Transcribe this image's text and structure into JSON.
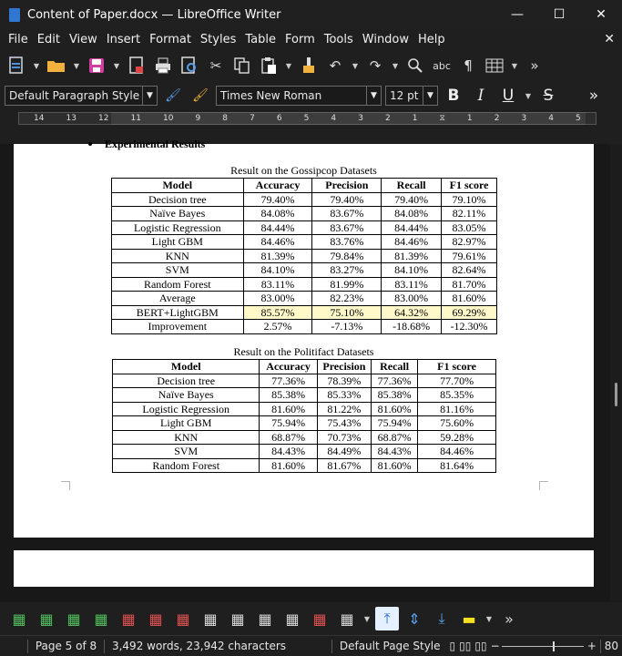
{
  "window": {
    "title": "Content of Paper.docx — LibreOffice Writer",
    "minimize": "—",
    "maximize": "☐",
    "close": "✕"
  },
  "menu": [
    "File",
    "Edit",
    "View",
    "Insert",
    "Format",
    "Styles",
    "Table",
    "Form",
    "Tools",
    "Window",
    "Help"
  ],
  "menu_close": "✕",
  "toolbar_icons": [
    "new-document-icon",
    "open-folder-icon",
    "save-icon",
    "export-pdf-icon",
    "print-icon",
    "print-preview-icon",
    "cut-icon",
    "copy-icon",
    "paste-icon",
    "clone-formatting-icon",
    "undo-icon",
    "redo-icon",
    "find-replace-icon",
    "spelling-icon",
    "formatting-marks-icon",
    "insert-table-icon",
    "more-icon"
  ],
  "toolbar_spelling_label": "abc",
  "formatting": {
    "paragraph_style": "Default Paragraph Style",
    "font_name": "Times New Roman",
    "font_size": "12 pt",
    "bold": "B",
    "italic": "I",
    "underline": "U",
    "strike": "S",
    "more": "»"
  },
  "ruler": {
    "ticks": [
      "14",
      "13",
      "12",
      "11",
      "10",
      "9",
      "8",
      "7",
      "6",
      "5",
      "4",
      "3",
      "2",
      "1",
      "1",
      "2",
      "3",
      "4",
      "5"
    ]
  },
  "document": {
    "section_heading": "Experimental Results",
    "table1": {
      "caption": "Result on the Gossipcop Datasets",
      "headers": [
        "Model",
        "Accuracy",
        "Precision",
        "Recall",
        "F1 score"
      ],
      "rows": [
        [
          "Decision tree",
          "79.40%",
          "79.40%",
          "79.40%",
          "79.10%"
        ],
        [
          "Naïve Bayes",
          "84.08%",
          "83.67%",
          "84.08%",
          "82.11%"
        ],
        [
          "Logistic Regression",
          "84.44%",
          "83.67%",
          "84.44%",
          "83.05%"
        ],
        [
          "Light GBM",
          "84.46%",
          "83.76%",
          "84.46%",
          "82.97%"
        ],
        [
          "KNN",
          "81.39%",
          "79.84%",
          "81.39%",
          "79.61%"
        ],
        [
          "SVM",
          "84.10%",
          "83.27%",
          "84.10%",
          "82.64%"
        ],
        [
          "Random Forest",
          "83.11%",
          "81.99%",
          "83.11%",
          "81.70%"
        ],
        [
          "Average",
          "83.00%",
          "82.23%",
          "83.00%",
          "81.60%"
        ],
        [
          "BERT+LightGBM",
          "85.57%",
          "75.10%",
          "64.32%",
          "69.29%"
        ],
        [
          "Improvement",
          "2.57%",
          "-7.13%",
          "-18.68%",
          "-12.30%"
        ]
      ]
    },
    "table2": {
      "caption": "Result on the Politifact Datasets",
      "headers": [
        "Model",
        "Accuracy",
        "Precision",
        "Recall",
        "F1 score"
      ],
      "rows": [
        [
          "Decision tree",
          "77.36%",
          "78.39%",
          "77.36%",
          "77.70%"
        ],
        [
          "Naïve Bayes",
          "85.38%",
          "85.33%",
          "85.38%",
          "85.35%"
        ],
        [
          "Logistic Regression",
          "81.60%",
          "81.22%",
          "81.60%",
          "81.16%"
        ],
        [
          "Light GBM",
          "75.94%",
          "75.43%",
          "75.94%",
          "75.60%"
        ],
        [
          "KNN",
          "68.87%",
          "70.73%",
          "68.87%",
          "59.28%"
        ],
        [
          "SVM",
          "84.43%",
          "84.49%",
          "84.43%",
          "84.46%"
        ],
        [
          "Random Forest",
          "81.60%",
          "81.67%",
          "81.60%",
          "81.64%"
        ]
      ]
    }
  },
  "status": {
    "page": "Page 5 of 8",
    "words": "3,492 words, 23,942 characters",
    "page_style": "Default Page Style",
    "zoom_minus": "−",
    "zoom_plus": "+",
    "zoom": "80"
  },
  "bottom_toolbar_more": "»"
}
